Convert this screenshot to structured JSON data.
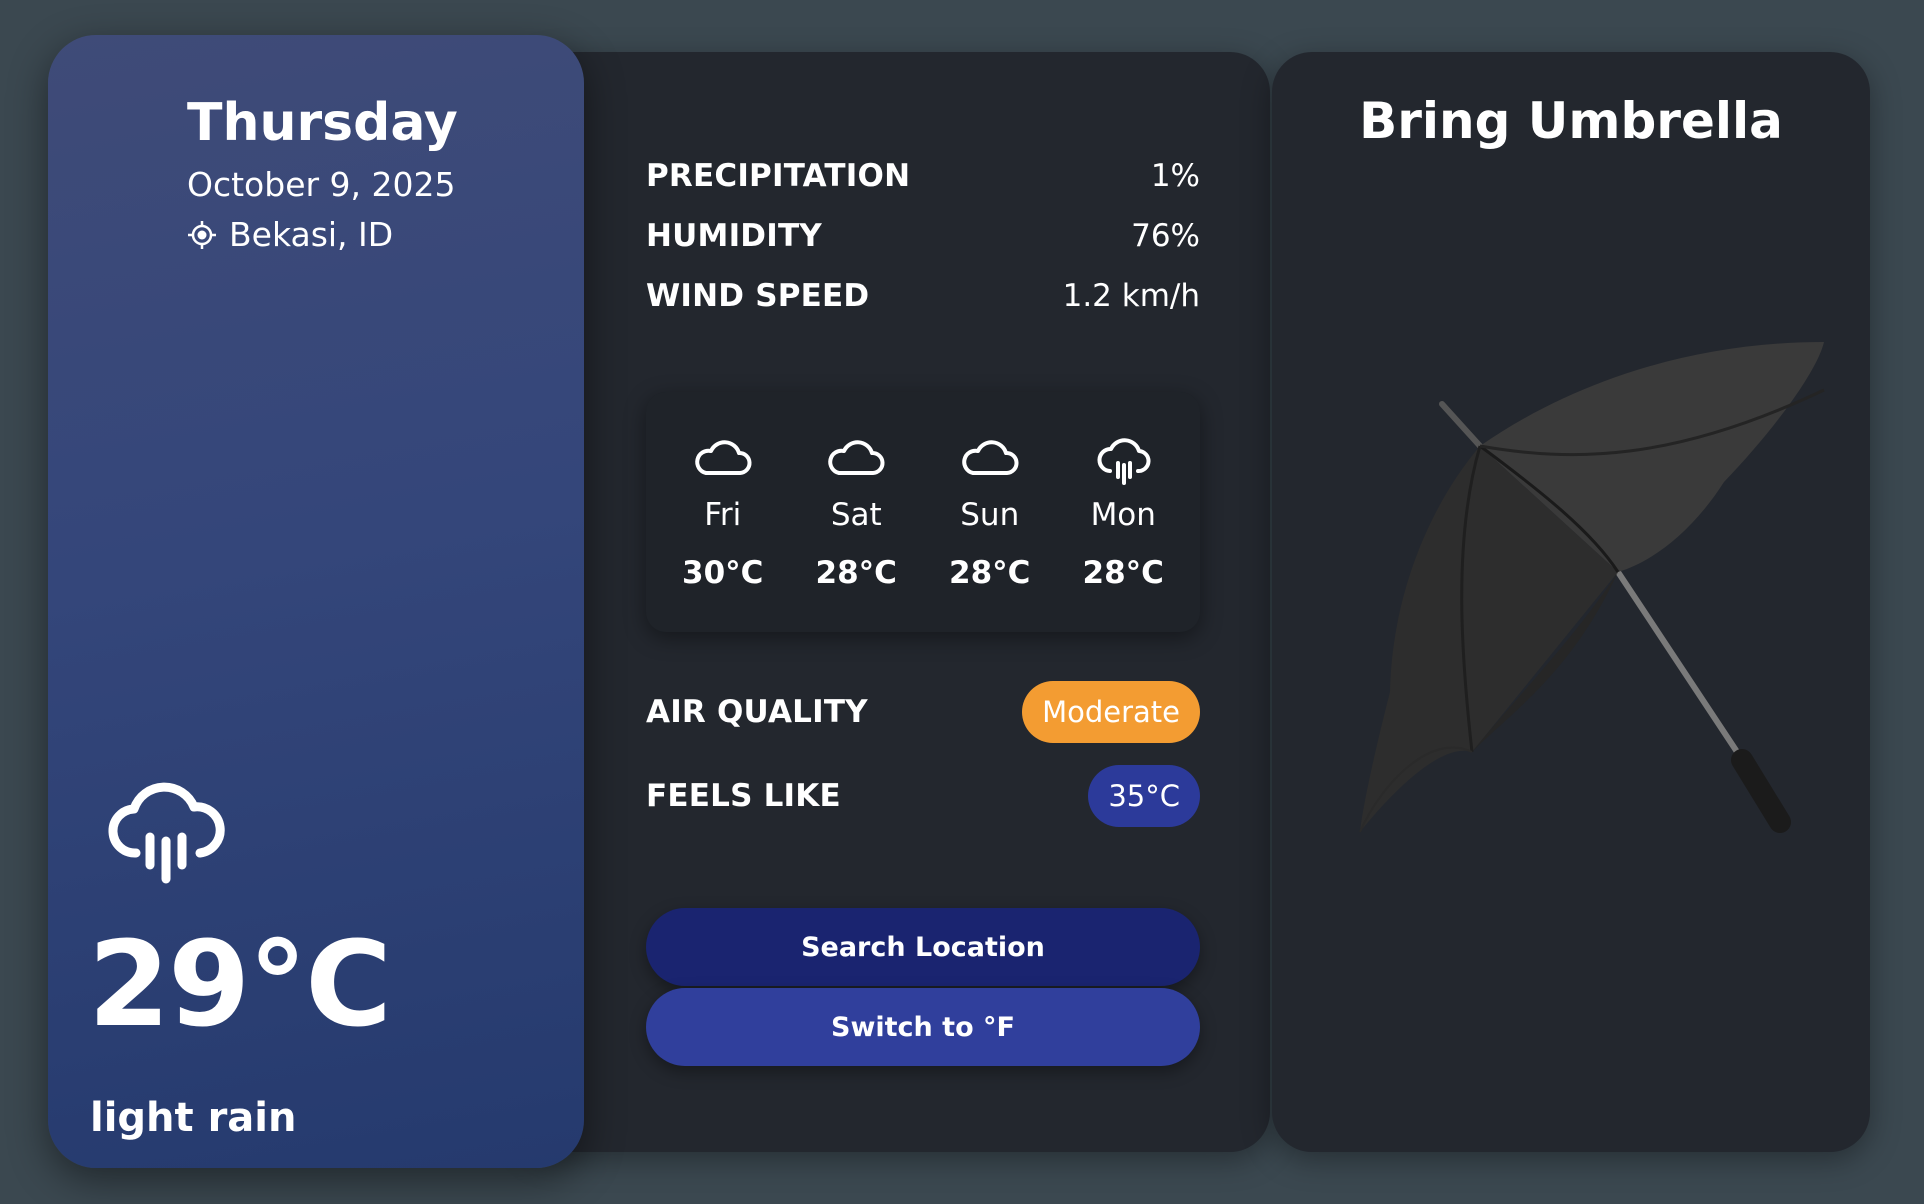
{
  "current": {
    "day": "Thursday",
    "date": "October 9, 2025",
    "location": "Bekasi, ID",
    "temperature": "29°C",
    "condition": "light rain",
    "icon": "cloud-rain-icon"
  },
  "stats": {
    "precipitation": {
      "label": "PRECIPITATION",
      "value": "1%"
    },
    "humidity": {
      "label": "HUMIDITY",
      "value": "76%"
    },
    "wind_speed": {
      "label": "WIND SPEED",
      "value": "1.2 km/h"
    }
  },
  "forecast": [
    {
      "day": "Fri",
      "temp": "30°C",
      "icon": "cloud-icon"
    },
    {
      "day": "Sat",
      "temp": "28°C",
      "icon": "cloud-icon"
    },
    {
      "day": "Sun",
      "temp": "28°C",
      "icon": "cloud-icon"
    },
    {
      "day": "Mon",
      "temp": "28°C",
      "icon": "cloud-rain-icon"
    }
  ],
  "air_quality": {
    "label": "AIR QUALITY",
    "value": "Moderate",
    "color": "#f39c32"
  },
  "feels_like": {
    "label": "FEELS LIKE",
    "value": "35°C",
    "color": "#2c3a9a"
  },
  "buttons": {
    "search": "Search Location",
    "switch_unit": "Switch to °F"
  },
  "advice": {
    "title": "Bring Umbrella",
    "image": "umbrella-image"
  },
  "colors": {
    "background": "#3b4850",
    "panel": "#23272e",
    "search_button": "#1a2470",
    "switch_button": "#303f9c"
  }
}
